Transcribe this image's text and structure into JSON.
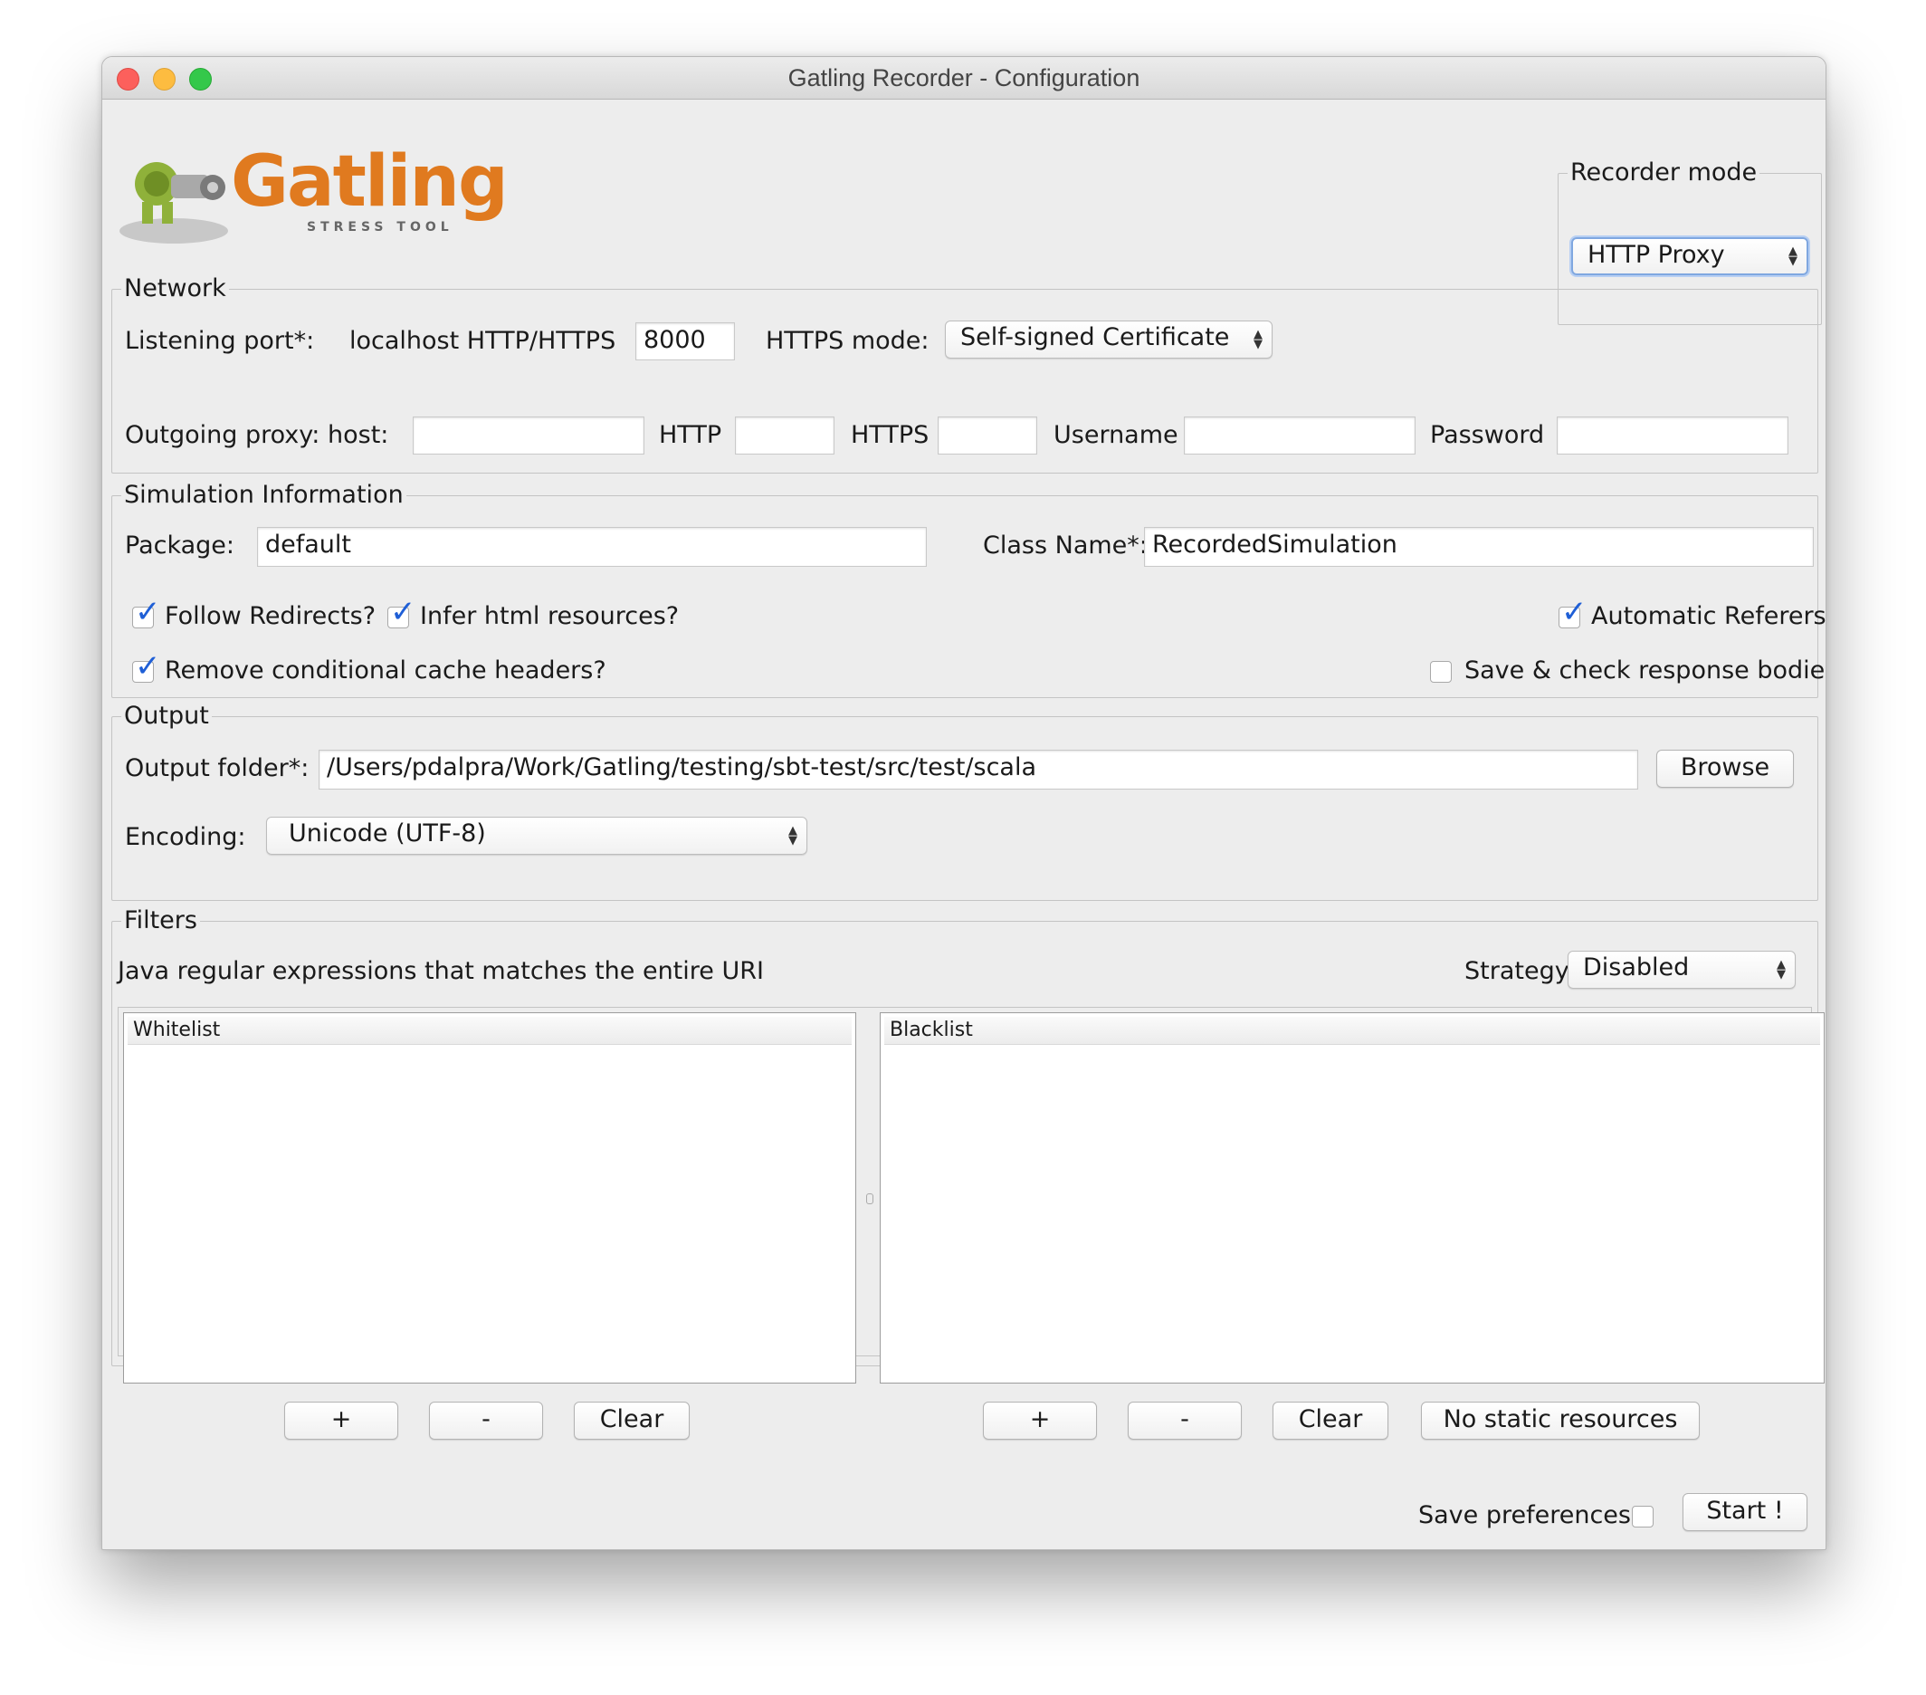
{
  "window": {
    "title": "Gatling Recorder - Configuration"
  },
  "logo": {
    "name": "Gatling",
    "tagline": "STRESS TOOL"
  },
  "recorder_mode": {
    "legend": "Recorder mode",
    "value": "HTTP Proxy"
  },
  "network": {
    "legend": "Network",
    "listening_port_label": "Listening port*:",
    "localhost_label": "localhost HTTP/HTTPS",
    "port_value": "8000",
    "https_mode_label": "HTTPS mode:",
    "https_mode_value": "Self-signed Certificate",
    "outgoing_proxy_label": "Outgoing proxy:",
    "host_label": "host:",
    "host_value": "",
    "http_label": "HTTP",
    "http_value": "",
    "https_label": "HTTPS",
    "https_value": "",
    "username_label": "Username",
    "username_value": "",
    "password_label": "Password",
    "password_value": ""
  },
  "simulation": {
    "legend": "Simulation Information",
    "package_label": "Package:",
    "package_value": "default",
    "class_name_label": "Class Name*:",
    "class_name_value": "RecordedSimulation",
    "follow_redirects": {
      "label": "Follow Redirects?",
      "checked": true
    },
    "infer_html": {
      "label": "Infer html resources?",
      "checked": true
    },
    "automatic_referers": {
      "label": "Automatic Referers?",
      "checked": true
    },
    "remove_cache_headers": {
      "label": "Remove conditional cache headers?",
      "checked": true
    },
    "save_bodies": {
      "label": "Save & check response bodies?",
      "checked": false
    }
  },
  "output": {
    "legend": "Output",
    "folder_label": "Output folder*:",
    "folder_value": "/Users/pdalpra/Work/Gatling/testing/sbt-test/src/test/scala",
    "browse_label": "Browse",
    "encoding_label": "Encoding:",
    "encoding_value": "Unicode (UTF-8)"
  },
  "filters": {
    "legend": "Filters",
    "description": "Java regular expressions that matches the entire URI",
    "strategy_label": "Strategy",
    "strategy_value": "Disabled",
    "whitelist": {
      "header": "Whitelist",
      "add": "+",
      "remove": "-",
      "clear": "Clear"
    },
    "blacklist": {
      "header": "Blacklist",
      "add": "+",
      "remove": "-",
      "clear": "Clear",
      "no_static": "No static resources"
    }
  },
  "footer": {
    "save_preferences_label": "Save preferences",
    "save_preferences_checked": false,
    "start_label": "Start !"
  },
  "colors": {
    "accent_check": "#1f5fd6",
    "logo_orange": "#e07a1f",
    "window_bg": "#ededed"
  }
}
